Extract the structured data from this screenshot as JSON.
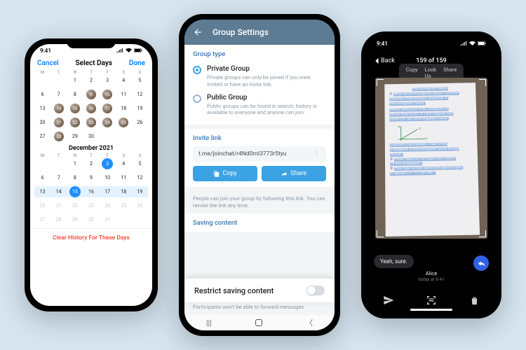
{
  "phone1": {
    "status_time": "9:41",
    "cancel": "Cancel",
    "title": "Select Days",
    "done": "Done",
    "weekdays": [
      "M",
      "T",
      "W",
      "T",
      "F",
      "S",
      "S"
    ],
    "month1_label": "",
    "month1_days": [
      "",
      "",
      "1",
      "2",
      "3",
      "4",
      "5",
      "6",
      "7",
      "8",
      "9",
      "10",
      "11",
      "12",
      "13",
      "14",
      "15",
      "16",
      "17",
      "18",
      "19",
      "20",
      "21",
      "22",
      "23",
      "24",
      "25",
      "26",
      "27",
      "28",
      "29",
      "30"
    ],
    "month1_avatars": [
      "9",
      "10",
      "14",
      "15",
      "16",
      "17",
      "21",
      "22",
      "23",
      "24",
      "25",
      "28"
    ],
    "month2_label": "December 2021",
    "month2_days": [
      "",
      "",
      "1",
      "2",
      "3",
      "4",
      "5",
      "6",
      "7",
      "8",
      "9",
      "10",
      "11",
      "12",
      "13",
      "14",
      "15",
      "16",
      "17",
      "18",
      "19",
      "20",
      "21",
      "22",
      "23",
      "24",
      "25",
      "26",
      "27",
      "28",
      "29",
      "30",
      "31"
    ],
    "month2_selected_single": "3",
    "month2_range_highlight": [
      "13",
      "14",
      "15",
      "16",
      "17",
      "18",
      "19"
    ],
    "month2_selected_range_anchor": "15",
    "clear_label": "Clear History For These Days"
  },
  "phone2": {
    "header": "Group Settings",
    "group_type_label": "Group type",
    "private_title": "Private Group",
    "private_desc": "Private groups can only be joined if you were invited or have an invite link.",
    "public_title": "Public Group",
    "public_desc": "Public groups can be found in search, history is available to everyone and anyone can join.",
    "invite_label": "Invite link",
    "invite_link": "t.me/joinchat/r4Nd0mI3773r5tyu",
    "copy": "Copy",
    "share": "Share",
    "hint": "People can join your group by following this link. You can revoke the link any time.",
    "saving_label": "Saving content",
    "restrict_label": "Restrict saving content",
    "restrict_desc": "Participants won't be able to forward messages"
  },
  "phone3": {
    "status_time": "9:41",
    "back": "Back",
    "counter": "159 of 159",
    "pill": [
      "Copy",
      "Look Up",
      "Share"
    ],
    "reply_text": "Yeah, sure.",
    "sender_name": "Alice",
    "sender_time": "today at 9:41"
  }
}
